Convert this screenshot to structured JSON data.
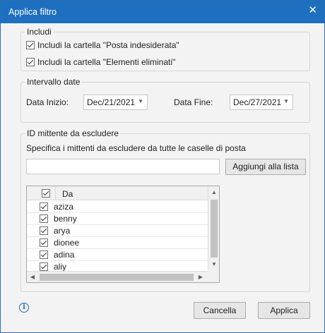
{
  "dialog": {
    "title": "Applica filtro",
    "close_glyph": "✕"
  },
  "include": {
    "legend": "Includi",
    "options": [
      {
        "label": "Includi la cartella \"Posta indesiderata\"",
        "checked": true
      },
      {
        "label": "Includi la cartella \"Elementi eliminati\"",
        "checked": true
      }
    ]
  },
  "dates": {
    "legend": "Intervallo date",
    "start_label": "Data Inizio:",
    "start_value": "Dec/21/2021",
    "end_label": "Data Fine:",
    "end_value": "Dec/27/2021"
  },
  "senders": {
    "legend": "ID mittente da escludere",
    "hint": "Specifica i mittenti da escludere da tutte le caselle di posta",
    "input_value": "",
    "add_button": "Aggiungi alla lista",
    "column_header": "Da",
    "rows": [
      "aziza",
      "benny",
      "arya",
      "dionee",
      "adina",
      "aliy"
    ]
  },
  "footer": {
    "cancel": "Cancella",
    "apply": "Applica"
  }
}
